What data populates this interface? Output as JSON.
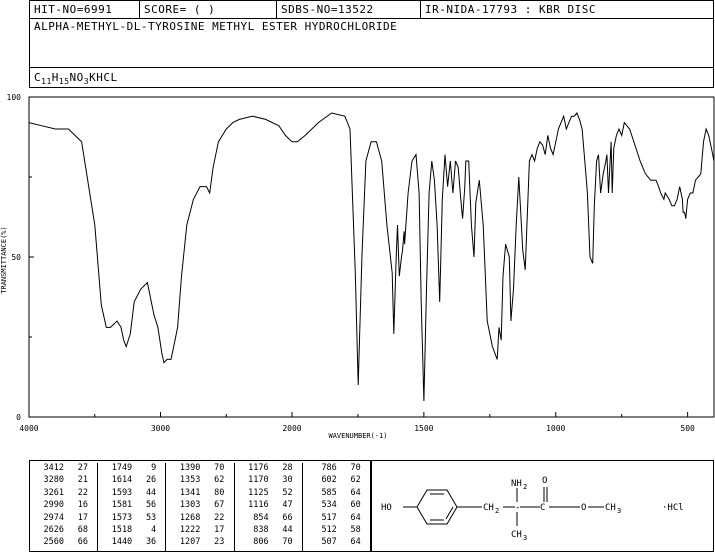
{
  "header": {
    "hit_no": "HIT-NO=6991",
    "score": "SCORE=  (    )",
    "sdbs_no": "SDBS-NO=13522",
    "ir_id": "IR-NIDA-17793 : KBR DISC",
    "compound": "ALPHA-METHYL-DL-TYROSINE METHYL ESTER HYDROCHLORIDE",
    "formula_parts": [
      "C",
      "11",
      "H",
      "15",
      "NO",
      "3",
      "KHCL"
    ]
  },
  "chart_data": {
    "type": "line",
    "xlabel": "WAVENUMBER(-1)",
    "ylabel": "TRANSMITTANCE(%)",
    "xlim": [
      4000,
      400
    ],
    "ylim": [
      0,
      100
    ],
    "xticks": [
      "4000",
      "3000",
      "2000",
      "1500",
      "1000",
      "500"
    ],
    "yticks": [
      "100",
      "50",
      "0"
    ],
    "series": [
      {
        "x": [
          4000,
          3900,
          3800,
          3700,
          3600,
          3500,
          3450,
          3412,
          3380,
          3330,
          3300,
          3280,
          3261,
          3230,
          3200,
          3150,
          3100,
          3050,
          3020,
          2990,
          2974,
          2950,
          2920,
          2900,
          2870,
          2840,
          2800,
          2750,
          2700,
          2650,
          2626,
          2600,
          2560,
          2500,
          2450,
          2400,
          2300,
          2200,
          2100,
          2050,
          2000,
          1980,
          1950,
          1900,
          1850,
          1800,
          1780,
          1760,
          1749,
          1735,
          1720,
          1700,
          1680,
          1660,
          1640,
          1620,
          1614,
          1605,
          1600,
          1593,
          1585,
          1581,
          1575,
          1573,
          1560,
          1545,
          1530,
          1518,
          1510,
          1500,
          1490,
          1480,
          1470,
          1460,
          1450,
          1440,
          1430,
          1420,
          1410,
          1400,
          1390,
          1380,
          1370,
          1360,
          1353,
          1345,
          1341,
          1330,
          1320,
          1310,
          1303,
          1290,
          1275,
          1268,
          1260,
          1240,
          1222,
          1215,
          1207,
          1200,
          1190,
          1176,
          1170,
          1160,
          1150,
          1140,
          1125,
          1116,
          1100,
          1090,
          1080,
          1070,
          1060,
          1050,
          1040,
          1030,
          1020,
          1010,
          1000,
          990,
          980,
          970,
          960,
          950,
          940,
          930,
          920,
          910,
          900,
          890,
          880,
          870,
          860,
          854,
          845,
          838,
          830,
          820,
          810,
          806,
          800,
          790,
          786,
          780,
          770,
          760,
          750,
          740,
          720,
          700,
          680,
          660,
          640,
          620,
          610,
          602,
          590,
          585,
          570,
          560,
          550,
          540,
          530,
          520,
          517,
          512,
          507,
          500,
          490,
          480,
          470,
          460,
          450,
          440,
          430,
          420,
          410,
          400
        ],
        "y": [
          92,
          91,
          90,
          90,
          86,
          60,
          35,
          28,
          28,
          30,
          28,
          24,
          22,
          26,
          36,
          40,
          42,
          32,
          28,
          20,
          17,
          18,
          18,
          22,
          28,
          44,
          60,
          68,
          72,
          72,
          70,
          78,
          86,
          90,
          92,
          93,
          94,
          93,
          91,
          88,
          86,
          86,
          88,
          92,
          95,
          94,
          90,
          45,
          10,
          50,
          80,
          86,
          86,
          80,
          60,
          45,
          26,
          50,
          60,
          44,
          50,
          52,
          58,
          54,
          70,
          80,
          82,
          70,
          36,
          5,
          40,
          70,
          80,
          74,
          60,
          36,
          68,
          82,
          72,
          80,
          70,
          80,
          78,
          68,
          62,
          72,
          80,
          80,
          60,
          50,
          67,
          74,
          60,
          46,
          30,
          22,
          18,
          28,
          24,
          44,
          54,
          50,
          30,
          40,
          60,
          75,
          52,
          46,
          80,
          82,
          80,
          84,
          86,
          85,
          82,
          88,
          84,
          82,
          86,
          90,
          92,
          94,
          90,
          92,
          94,
          94,
          95,
          93,
          90,
          80,
          70,
          50,
          48,
          66,
          80,
          82,
          70,
          76,
          80,
          82,
          70,
          86,
          70,
          84,
          88,
          90,
          88,
          92,
          90,
          85,
          80,
          76,
          74,
          74,
          72,
          70,
          68,
          70,
          68,
          66,
          66,
          68,
          72,
          68,
          64,
          64,
          62,
          68,
          70,
          70,
          74,
          75,
          76,
          86,
          90,
          88,
          84,
          80
        ]
      }
    ]
  },
  "peaks": [
    {
      "w": "3412",
      "t": "27"
    },
    {
      "w": "3280",
      "t": "21"
    },
    {
      "w": "3261",
      "t": "22"
    },
    {
      "w": "2990",
      "t": "16"
    },
    {
      "w": "2974",
      "t": "17"
    },
    {
      "w": "2626",
      "t": "68"
    },
    {
      "w": "2560",
      "t": "66"
    },
    {
      "w": "1749",
      "t": "9"
    },
    {
      "w": "1614",
      "t": "26"
    },
    {
      "w": "1593",
      "t": "44"
    },
    {
      "w": "1581",
      "t": "56"
    },
    {
      "w": "1573",
      "t": "53"
    },
    {
      "w": "1518",
      "t": "4"
    },
    {
      "w": "1440",
      "t": "36"
    },
    {
      "w": "1390",
      "t": "70"
    },
    {
      "w": "1353",
      "t": "62"
    },
    {
      "w": "1341",
      "t": "80"
    },
    {
      "w": "1303",
      "t": "67"
    },
    {
      "w": "1268",
      "t": "22"
    },
    {
      "w": "1222",
      "t": "17"
    },
    {
      "w": "1207",
      "t": "23"
    },
    {
      "w": "1176",
      "t": "28"
    },
    {
      "w": "1170",
      "t": "30"
    },
    {
      "w": "1125",
      "t": "52"
    },
    {
      "w": "1116",
      "t": "47"
    },
    {
      "w": "854",
      "t": "66"
    },
    {
      "w": "838",
      "t": "44"
    },
    {
      "w": "806",
      "t": "70"
    },
    {
      "w": "786",
      "t": "70"
    },
    {
      "w": "602",
      "t": "62"
    },
    {
      "w": "585",
      "t": "64"
    },
    {
      "w": "534",
      "t": "60"
    },
    {
      "w": "517",
      "t": "64"
    },
    {
      "w": "512",
      "t": "58"
    },
    {
      "w": "507",
      "t": "64"
    }
  ],
  "structure": {
    "ho": "HO",
    "ch2": "CH",
    "ch2_sub": "2",
    "nh2": "NH",
    "nh2_sub": "2",
    "o_carbonyl": "O",
    "o_ester": "O",
    "ch3_ester": "CH",
    "ch3_ester_sub": "3",
    "ch3_alpha": "CH",
    "ch3_alpha_sub": "3",
    "hcl": "·HCl"
  }
}
